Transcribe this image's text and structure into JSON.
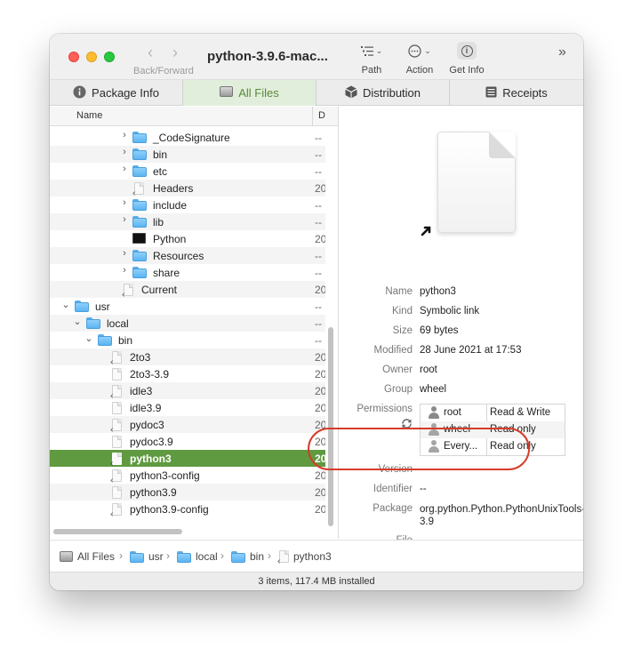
{
  "window": {
    "title": "python-3.9.6-mac...",
    "nav_label": "Back/Forward",
    "toolbar": {
      "path_label": "Path",
      "action_label": "Action",
      "get_info_label": "Get Info"
    }
  },
  "tabs": [
    {
      "label": "Package Info",
      "icon": "info-icon"
    },
    {
      "label": "All Files",
      "icon": "disk-icon",
      "active": true
    },
    {
      "label": "Distribution",
      "icon": "package-icon"
    },
    {
      "label": "Receipts",
      "icon": "receipt-icon"
    }
  ],
  "list": {
    "headers": {
      "name": "Name",
      "date": "D"
    },
    "rows": [
      {
        "name": "_CodeSignature",
        "type": "folder",
        "date": "--"
      },
      {
        "name": "bin",
        "type": "folder",
        "date": "--"
      },
      {
        "name": "etc",
        "type": "folder",
        "date": "--"
      },
      {
        "name": "Headers",
        "type": "doc",
        "date": "20"
      },
      {
        "name": "include",
        "type": "folder",
        "date": "--"
      },
      {
        "name": "lib",
        "type": "folder",
        "date": "--"
      },
      {
        "name": "Python",
        "type": "exec",
        "date": "20"
      },
      {
        "name": "Resources",
        "type": "folder",
        "date": "--"
      },
      {
        "name": "share",
        "type": "folder",
        "date": "--"
      },
      {
        "name": "Current",
        "type": "doc",
        "date": "20"
      },
      {
        "name": "usr",
        "type": "folder",
        "date": "--"
      },
      {
        "name": "local",
        "type": "folder",
        "date": "--"
      },
      {
        "name": "bin",
        "type": "folder",
        "date": "--"
      },
      {
        "name": "2to3",
        "type": "doc",
        "date": "20"
      },
      {
        "name": "2to3-3.9",
        "type": "doc",
        "date": "20"
      },
      {
        "name": "idle3",
        "type": "doc",
        "date": "20"
      },
      {
        "name": "idle3.9",
        "type": "doc",
        "date": "20"
      },
      {
        "name": "pydoc3",
        "type": "doc",
        "date": "20"
      },
      {
        "name": "pydoc3.9",
        "type": "doc",
        "date": "20"
      },
      {
        "name": "python3",
        "type": "doc",
        "date": "20",
        "selected": true
      },
      {
        "name": "python3-config",
        "type": "doc",
        "date": "20"
      },
      {
        "name": "python3.9",
        "type": "doc",
        "date": "20"
      },
      {
        "name": "python3.9-config",
        "type": "doc",
        "date": "20"
      }
    ]
  },
  "info": {
    "name_key": "Name",
    "name": "python3",
    "kind_key": "Kind",
    "kind": "Symbolic link",
    "size_key": "Size",
    "size": "69 bytes",
    "modified_key": "Modified",
    "modified": "28 June 2021 at 17:53",
    "owner_key": "Owner",
    "owner": "root",
    "group_key": "Group",
    "group": "wheel",
    "permissions_key": "Permissions",
    "permissions": [
      {
        "who": "root",
        "access": "Read & Write"
      },
      {
        "who": "wheel",
        "access": "Read only"
      },
      {
        "who": "Every...",
        "access": "Read only"
      }
    ],
    "version_key": "Version",
    "version": "--",
    "identifier_key": "Identifier",
    "identifier": "--",
    "package_key": "Package",
    "package": "org.python.Python.PythonUnixTools-3.9",
    "file_key": "File",
    "file": "--"
  },
  "pathbar": [
    "All Files",
    "usr",
    "local",
    "bin",
    "python3"
  ],
  "status": "3 items, 117.4 MB installed",
  "colors": {
    "accent": "#5f9a40",
    "highlight": "#d63b2a"
  }
}
